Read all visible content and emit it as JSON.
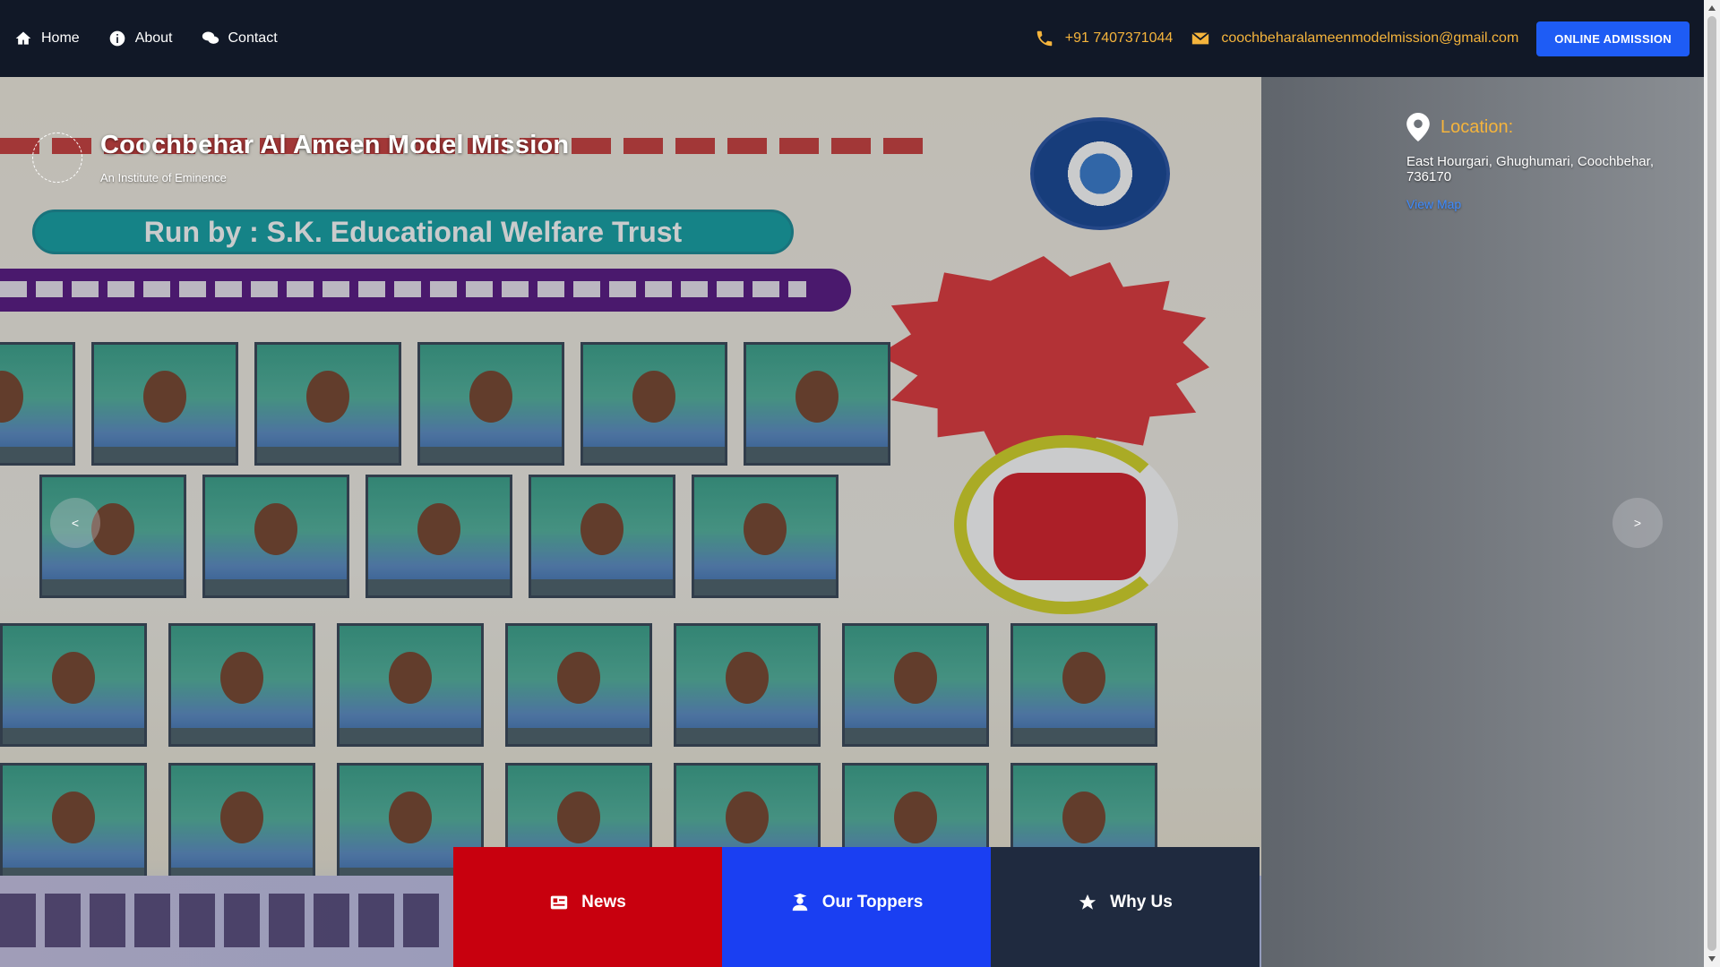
{
  "nav": {
    "items": [
      {
        "label": "Home",
        "icon": "home-icon"
      },
      {
        "label": "About",
        "icon": "info-icon"
      },
      {
        "label": "Contact",
        "icon": "chat-icon"
      }
    ]
  },
  "contact": {
    "phone": "+91 7407371044",
    "email": "coochbeharalameenmodelmission@gmail.com",
    "admission_label": "ONLINE ADMISSION"
  },
  "brand": {
    "name": "Coochbehar Al Ameen Model Mission",
    "tagline": "An Institute of Eminence"
  },
  "location": {
    "heading": "Location:",
    "address": "East Hourgari, Ghughumari, Coochbehar, 736170",
    "link_label": "View Map"
  },
  "poster": {
    "pill_text": "Run by : S.K. Educational Welfare Trust"
  },
  "slider": {
    "prev_label": "<",
    "next_label": ">"
  },
  "tabs": [
    {
      "label": "News",
      "icon": "newspaper-icon"
    },
    {
      "label": "Our Toppers",
      "icon": "graduate-icon"
    },
    {
      "label": "Why Us",
      "icon": "star-icon"
    }
  ],
  "colors": {
    "topbar": "#111827",
    "accent": "#f5b43c",
    "admission": "#1e5cf5",
    "news": "#c8000e",
    "toppers": "#1a3ff2",
    "why": "#1f2a3f"
  }
}
